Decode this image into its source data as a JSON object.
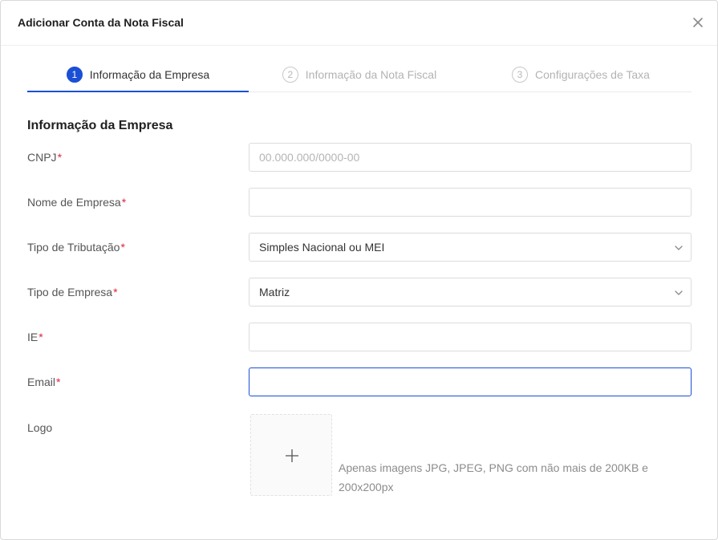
{
  "dialog": {
    "title": "Adicionar Conta da Nota Fiscal"
  },
  "steps": [
    {
      "number": "1",
      "label": "Informação da Empresa",
      "active": true
    },
    {
      "number": "2",
      "label": "Informação da Nota Fiscal",
      "active": false
    },
    {
      "number": "3",
      "label": "Configurações de Taxa",
      "active": false
    }
  ],
  "section": {
    "title": "Informação da Empresa"
  },
  "form": {
    "required_mark": "*",
    "cnpj": {
      "label": "CNPJ",
      "value": "",
      "placeholder": "00.000.000/0000-00"
    },
    "company_name": {
      "label": "Nome de Empresa",
      "value": ""
    },
    "tax_type": {
      "label": "Tipo de Tributação",
      "selected": "Simples Nacional ou MEI"
    },
    "company_type": {
      "label": "Tipo de Empresa",
      "selected": "Matriz"
    },
    "ie": {
      "label": "IE",
      "value": ""
    },
    "email": {
      "label": "Email",
      "value": ""
    },
    "logo": {
      "label": "Logo",
      "hint": "Apenas imagens JPG, JPEG, PNG com não mais de 200KB e 200x200px"
    }
  },
  "icons": {
    "close": "close-icon",
    "chevron": "chevron-down-icon",
    "plus": "plus-icon"
  },
  "colors": {
    "accent": "#1a4fd6",
    "required": "#e0243a"
  }
}
